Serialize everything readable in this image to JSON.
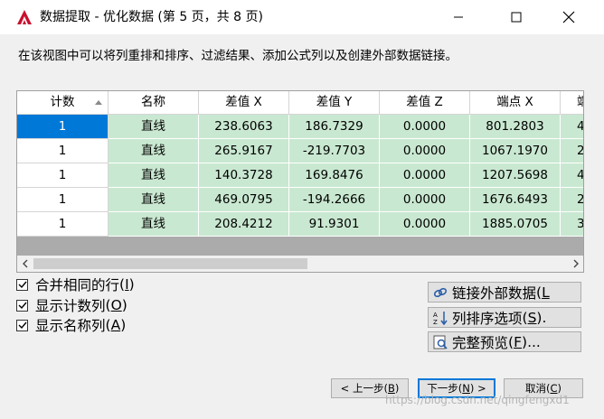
{
  "window": {
    "title": "数据提取 - 优化数据 (第 5 页，共 8 页)",
    "icon": "autocad-icon",
    "controls": [
      "minimize",
      "maximize",
      "close"
    ]
  },
  "description": "在该视图中可以将列重排和排序、过滤结果、添加公式列以及创建外部数据链接。",
  "grid": {
    "columns": [
      "计数",
      "名称",
      "差值 X",
      "差值 Y",
      "差值 Z",
      "端点 X",
      "端"
    ],
    "sorted_column": "计数",
    "rows": [
      [
        "1",
        "直线",
        "238.6063",
        "186.7329",
        "0.0000",
        "801.2803",
        "4"
      ],
      [
        "1",
        "直线",
        "265.9167",
        "-219.7703",
        "0.0000",
        "1067.1970",
        "2"
      ],
      [
        "1",
        "直线",
        "140.3728",
        "169.8476",
        "0.0000",
        "1207.5698",
        "4"
      ],
      [
        "1",
        "直线",
        "469.0795",
        "-194.2666",
        "0.0000",
        "1676.6493",
        "2"
      ],
      [
        "1",
        "直线",
        "208.4212",
        "91.9301",
        "0.0000",
        "1885.0705",
        "3"
      ]
    ],
    "selected_cell": {
      "row": 0,
      "column": 0
    },
    "cell_color": "#c9e8d1",
    "selection_color": "#0078d7",
    "scroll_position": 0.0
  },
  "options": {
    "combine_rows": {
      "label": "合并相同的行",
      "accel": "I",
      "checked": true
    },
    "show_count": {
      "label": "显示计数列",
      "accel": "O",
      "checked": true
    },
    "show_name": {
      "label": "显示名称列",
      "accel": "A",
      "checked": true
    }
  },
  "actions": {
    "link_external": {
      "label": "链接外部数据",
      "accel": "L",
      "icon": "link-icon"
    },
    "sort_options": {
      "label": "列排序选项",
      "accel": "S",
      "suffix": ".",
      "icon": "sort-icon"
    },
    "full_preview": {
      "label": "完整预览",
      "accel": "F",
      "suffix": "...",
      "icon": "preview-icon"
    }
  },
  "footer": {
    "prev": {
      "label": "< 上一步",
      "accel": "B"
    },
    "next": {
      "label": "下一步",
      "accel": "N",
      "suffix": " >"
    },
    "cancel": {
      "label": "取消",
      "accel": "C"
    }
  },
  "watermark": "https://blog.csdn.net/qingfengxd1"
}
